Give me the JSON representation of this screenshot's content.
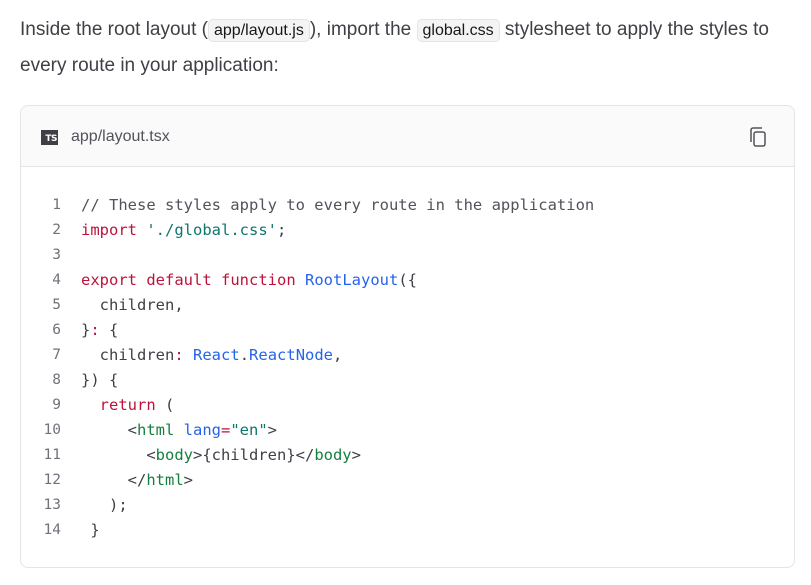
{
  "intro": {
    "before": "Inside the root layout (",
    "code1": "app/layout.js",
    "middle": "), import the ",
    "code2": "global.css",
    "after": " stylesheet to apply the styles to every route in your application:"
  },
  "code_block": {
    "icon_text": "TS",
    "filename": "app/layout.tsx",
    "copy_icon": "copy-icon",
    "lines": [
      {
        "num": "1",
        "tokens": [
          {
            "t": "// These styles apply to every route in the application",
            "c": "comment"
          }
        ]
      },
      {
        "num": "2",
        "tokens": [
          {
            "t": "import",
            "c": "keyword"
          },
          {
            "t": " ",
            "c": "punct"
          },
          {
            "t": "'./global.css'",
            "c": "string"
          },
          {
            "t": ";",
            "c": "punct"
          }
        ]
      },
      {
        "num": "3",
        "tokens": []
      },
      {
        "num": "4",
        "tokens": [
          {
            "t": "export",
            "c": "keyword"
          },
          {
            "t": " ",
            "c": "punct"
          },
          {
            "t": "default",
            "c": "keyword"
          },
          {
            "t": " ",
            "c": "punct"
          },
          {
            "t": "function",
            "c": "keyword"
          },
          {
            "t": " ",
            "c": "punct"
          },
          {
            "t": "RootLayout",
            "c": "func"
          },
          {
            "t": "({",
            "c": "punct"
          }
        ]
      },
      {
        "num": "5",
        "tokens": [
          {
            "t": "  children,",
            "c": "punct"
          }
        ]
      },
      {
        "num": "6",
        "tokens": [
          {
            "t": "}",
            "c": "punct"
          },
          {
            "t": ":",
            "c": "keyword"
          },
          {
            "t": " {",
            "c": "punct"
          }
        ]
      },
      {
        "num": "7",
        "tokens": [
          {
            "t": "  children",
            "c": "punct"
          },
          {
            "t": ":",
            "c": "keyword"
          },
          {
            "t": " ",
            "c": "punct"
          },
          {
            "t": "React",
            "c": "type"
          },
          {
            "t": ".",
            "c": "punct"
          },
          {
            "t": "ReactNode",
            "c": "type"
          },
          {
            "t": ",",
            "c": "punct"
          }
        ]
      },
      {
        "num": "8",
        "tokens": [
          {
            "t": "}) {",
            "c": "punct"
          }
        ]
      },
      {
        "num": "9",
        "tokens": [
          {
            "t": "  ",
            "c": "punct"
          },
          {
            "t": "return",
            "c": "keyword"
          },
          {
            "t": " (",
            "c": "punct"
          }
        ]
      },
      {
        "num": "10",
        "tokens": [
          {
            "t": "     <",
            "c": "punct"
          },
          {
            "t": "html",
            "c": "tag"
          },
          {
            "t": " ",
            "c": "punct"
          },
          {
            "t": "lang",
            "c": "attr"
          },
          {
            "t": "=",
            "c": "keyword"
          },
          {
            "t": "\"en\"",
            "c": "string"
          },
          {
            "t": ">",
            "c": "punct"
          }
        ]
      },
      {
        "num": "11",
        "tokens": [
          {
            "t": "       <",
            "c": "punct"
          },
          {
            "t": "body",
            "c": "tag"
          },
          {
            "t": ">{children}</",
            "c": "punct"
          },
          {
            "t": "body",
            "c": "tag"
          },
          {
            "t": ">",
            "c": "punct"
          }
        ]
      },
      {
        "num": "12",
        "tokens": [
          {
            "t": "     </",
            "c": "punct"
          },
          {
            "t": "html",
            "c": "tag"
          },
          {
            "t": ">",
            "c": "punct"
          }
        ]
      },
      {
        "num": "13",
        "tokens": [
          {
            "t": "   );",
            "c": "punct"
          }
        ]
      },
      {
        "num": "14",
        "tokens": [
          {
            "t": " }",
            "c": "punct"
          }
        ]
      }
    ]
  }
}
